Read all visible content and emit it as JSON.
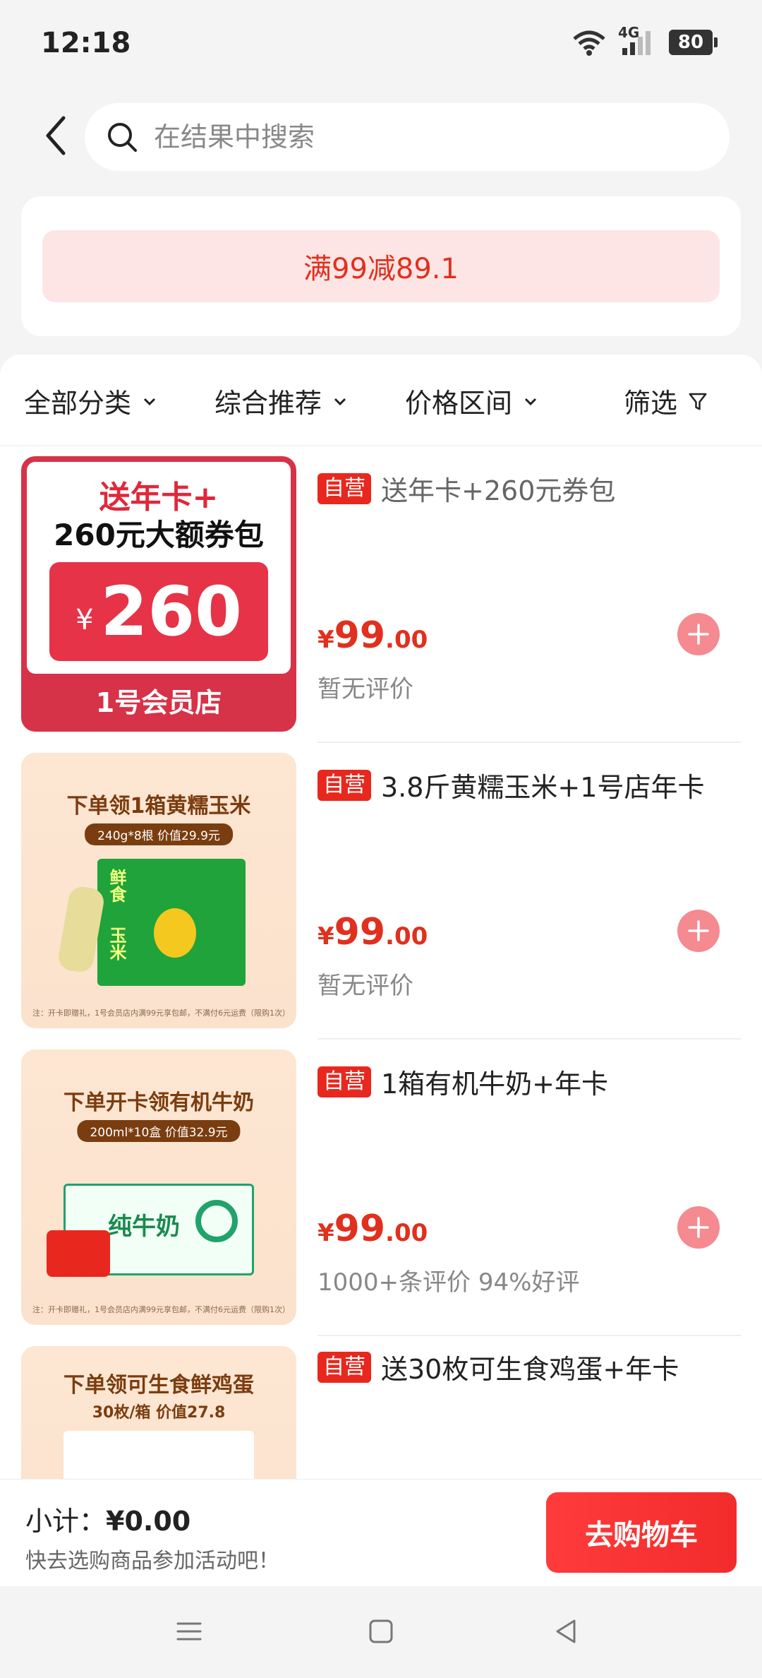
{
  "status": {
    "time": "12:18",
    "network": "4G",
    "battery": "80"
  },
  "search": {
    "placeholder": "在结果中搜索"
  },
  "promo": {
    "text": "满99减89.1"
  },
  "filters": [
    {
      "label": "全部分类"
    },
    {
      "label": "综合推荐"
    },
    {
      "label": "价格区间"
    },
    {
      "label": "筛选"
    }
  ],
  "products": [
    {
      "badge": "自营",
      "title": "送年卡+260元券包",
      "price_symbol": "¥",
      "price_int": "99",
      "price_dec": ".00",
      "review": "暂无评价",
      "thumb": {
        "line1": "送年卡+",
        "line2": "260元大额券包",
        "coupon_symbol": "¥",
        "coupon_value": "260",
        "store": "1号会员店"
      }
    },
    {
      "badge": "自营",
      "title": "3.8斤黄糯玉米+1号店年卡",
      "price_symbol": "¥",
      "price_int": "99",
      "price_dec": ".00",
      "review": "暂无评价",
      "thumb": {
        "headline": "下单领1箱黄糯玉米",
        "sub": "240g*8根  价值29.9元",
        "box_a": "鲜食",
        "box_b": "玉米",
        "note": "注：开卡即赠礼，1号会员店内满99元享包邮，不满付6元运费（限购1次）"
      }
    },
    {
      "badge": "自营",
      "title": "1箱有机牛奶+年卡",
      "price_symbol": "¥",
      "price_int": "99",
      "price_dec": ".00",
      "review": "1000+条评价  94%好评",
      "thumb": {
        "headline": "下单开卡领有机牛奶",
        "sub": "200ml*10盒  价值32.9元",
        "box_text": "纯牛奶",
        "note": "注：开卡即赠礼，1号会员店内满99元享包邮，不满付6元运费（限购1次）"
      }
    },
    {
      "badge": "自营",
      "title": "送30枚可生食鸡蛋+年卡",
      "thumb": {
        "headline": "下单领可生食鲜鸡蛋",
        "sub": "30枚/箱  价值27.8"
      }
    }
  ],
  "bottom": {
    "subtotal_label": "小计：",
    "subtotal_value": "¥0.00",
    "hint": "快去选购商品参加活动吧！",
    "cart_button": "去购物车"
  },
  "icons": {
    "back": "chevron-left-icon",
    "search": "search-icon",
    "dropdown": "chevron-down-icon",
    "filter": "filter-funnel-icon",
    "add": "plus-circle-icon",
    "nav_menu": "menu-icon",
    "nav_home": "square-home-icon",
    "nav_back": "triangle-back-icon"
  },
  "colors": {
    "accent": "#e8281e",
    "promo_bg": "#fde5e5",
    "add_button": "#f58a90"
  }
}
